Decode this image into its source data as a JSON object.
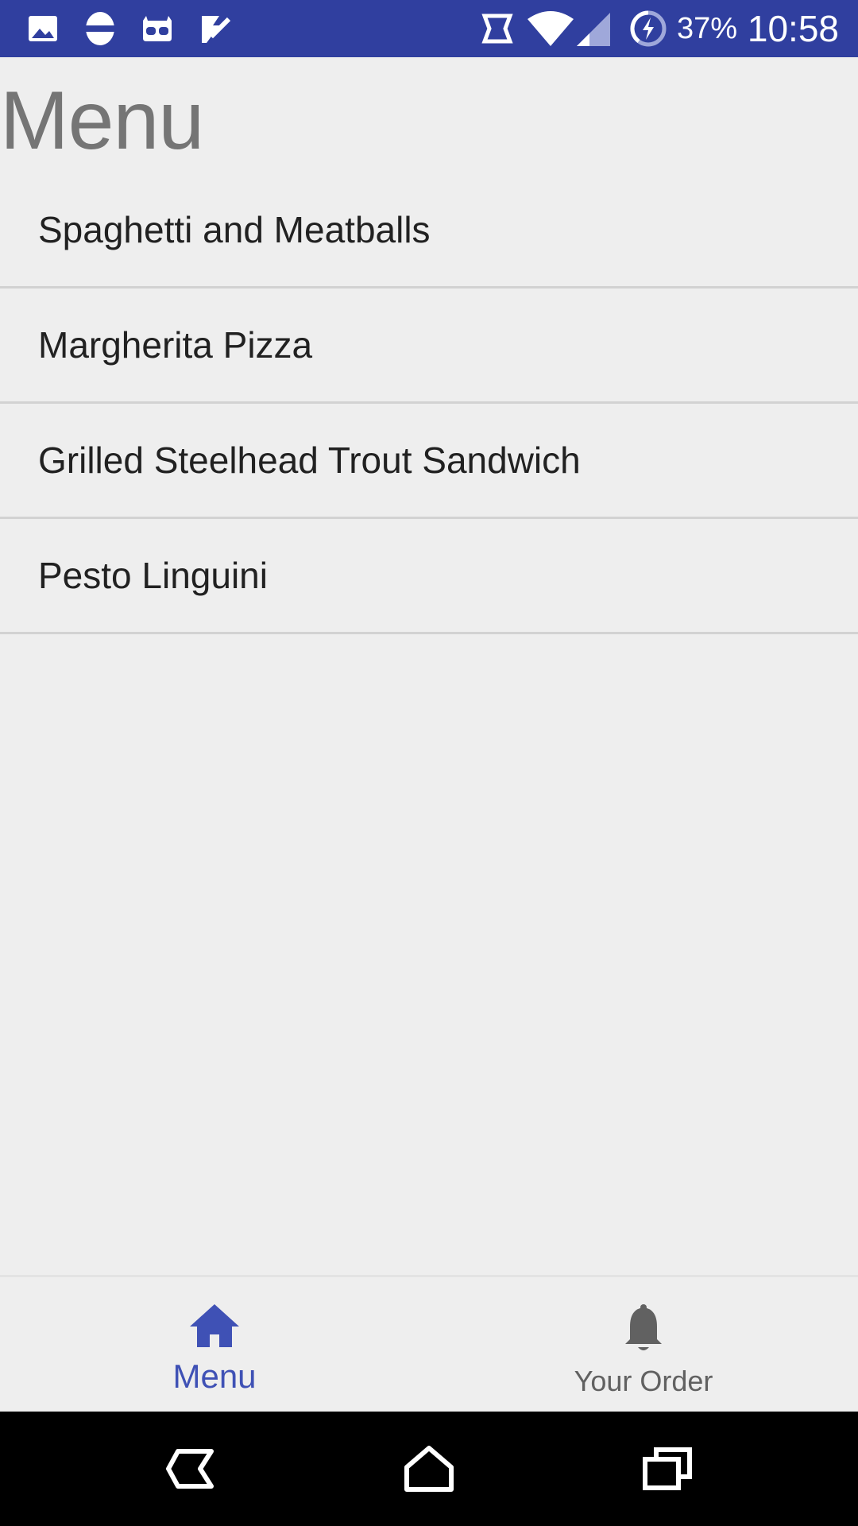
{
  "status_bar": {
    "battery": "37%",
    "time": "10:58",
    "left_icons": [
      "image-icon",
      "sync-icon",
      "cyanogen-icon",
      "task-check-icon"
    ],
    "right_icons": [
      "vibrate-icon",
      "wifi-icon",
      "signal-icon",
      "battery-charging-icon"
    ]
  },
  "page": {
    "title": "Menu"
  },
  "menu": {
    "items": [
      {
        "label": "Spaghetti and Meatballs"
      },
      {
        "label": "Margherita Pizza"
      },
      {
        "label": "Grilled Steelhead Trout Sandwich"
      },
      {
        "label": "Pesto Linguini"
      }
    ]
  },
  "bottom_nav": {
    "tabs": [
      {
        "label": "Menu",
        "icon": "home-icon",
        "active": true
      },
      {
        "label": "Your Order",
        "icon": "bell-icon",
        "active": false
      }
    ]
  },
  "system_nav": {
    "buttons": [
      "back-icon",
      "home-button-icon",
      "recents-icon"
    ]
  },
  "colors": {
    "status_bar": "#303f9f",
    "accent": "#3f51b5",
    "inactive": "#616161",
    "background": "#eeeeee",
    "text_primary": "#212121",
    "title": "#757575"
  }
}
